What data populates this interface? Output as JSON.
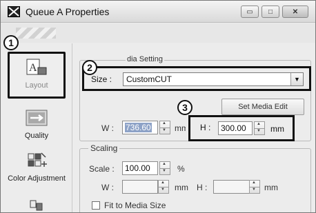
{
  "window": {
    "title": "Queue A Properties",
    "buttons": {
      "minimize": "▭",
      "maximize": "□",
      "close": "✕"
    }
  },
  "sidebar": {
    "items": [
      {
        "label": "Layout",
        "icon": "layout-icon",
        "selected": true
      },
      {
        "label": "Quality",
        "icon": "quality-icon"
      },
      {
        "label": "Color Adjustment",
        "icon": "color-adjustment-icon"
      },
      {
        "label": "",
        "icon": "more-icon"
      }
    ]
  },
  "media": {
    "legend": "dia Setting",
    "size_label": "Size :",
    "size_value": "CustomCUT",
    "w_label": "W :",
    "w_value": "736.60",
    "w_unit": "mm",
    "h_label": "H :",
    "h_value": "300.00",
    "h_unit": "mm",
    "edit_button": "Set Media Edit"
  },
  "scaling": {
    "legend": "Scaling",
    "scale_label": "Scale :",
    "scale_value": "100.00",
    "scale_unit": "%",
    "w_label": "W :",
    "w_value": "",
    "w_unit": "mm",
    "h_label": "H :",
    "h_value": "",
    "h_unit": "mm",
    "fit_label": "Fit to Media Size"
  },
  "callouts": [
    "1",
    "2",
    "3"
  ]
}
